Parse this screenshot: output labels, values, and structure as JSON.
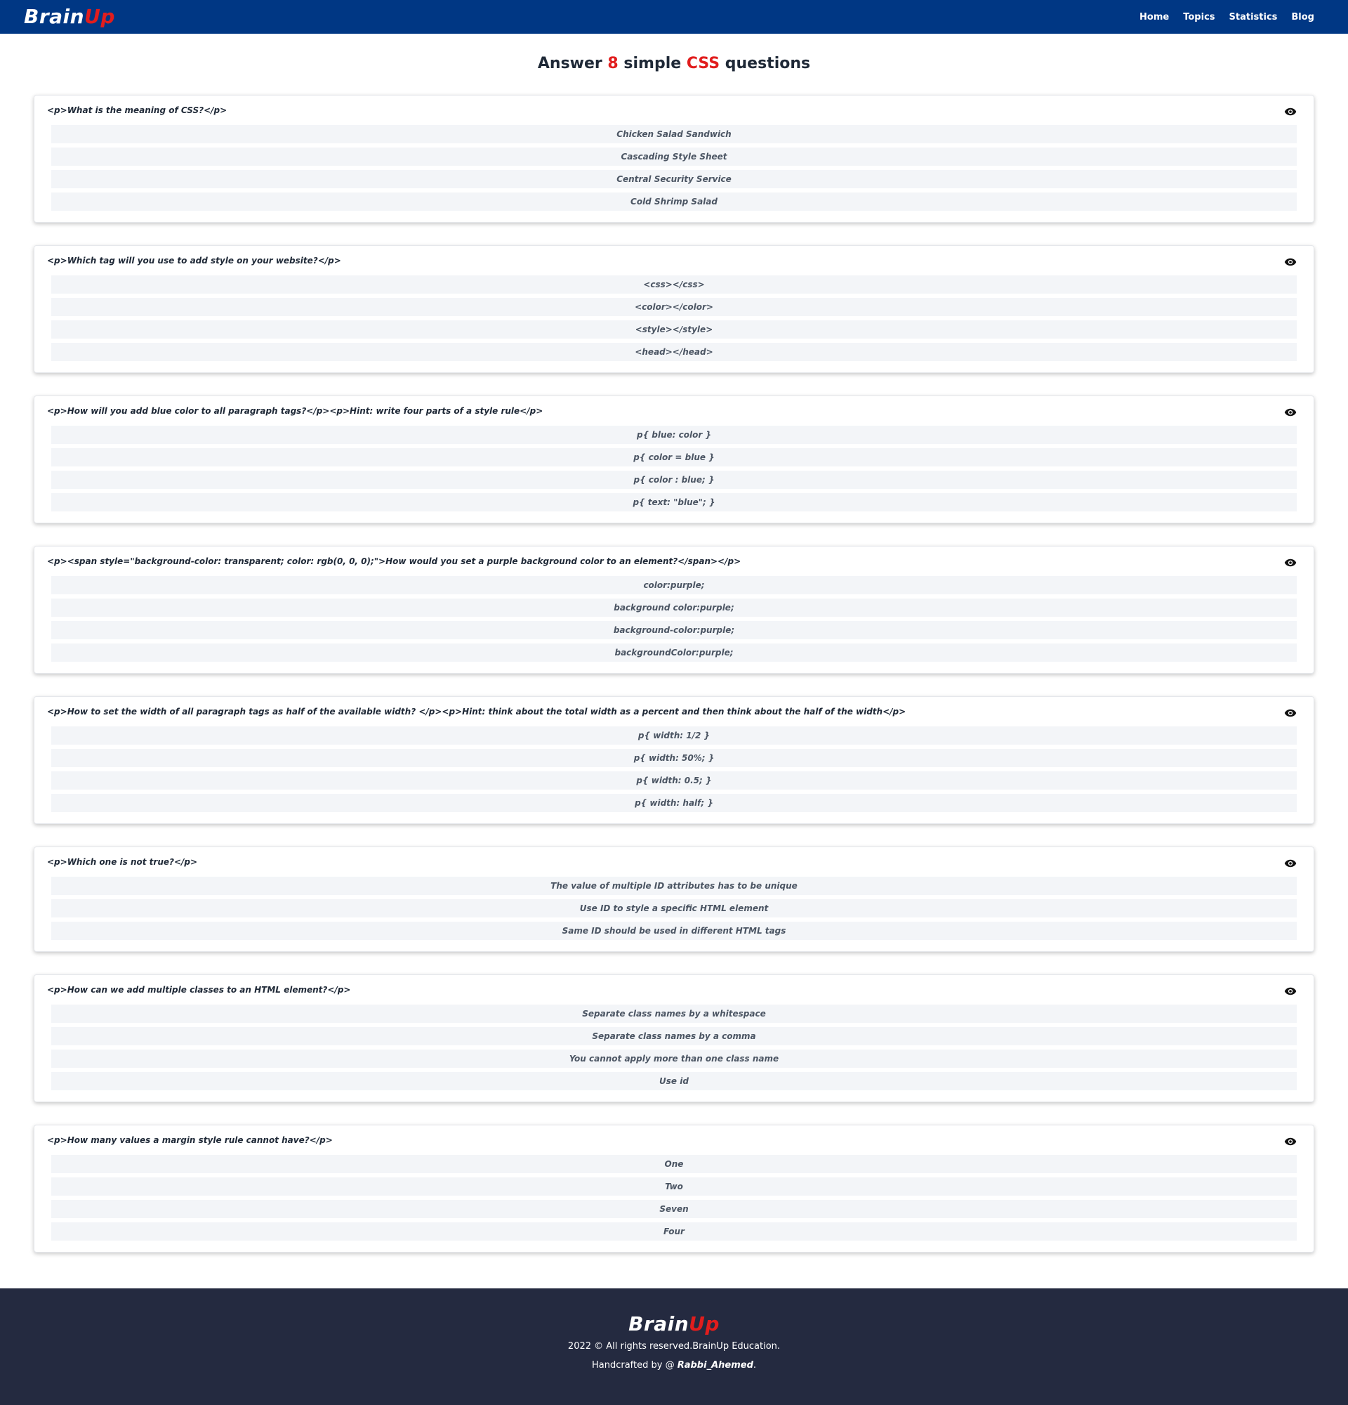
{
  "nav": {
    "brand_part1": "Brain",
    "brand_part2": "Up",
    "links": [
      "Home",
      "Topics",
      "Statistics",
      "Blog"
    ]
  },
  "title": {
    "prefix": "Answer ",
    "count": "8",
    "middle": " simple ",
    "topic": "CSS",
    "suffix": " questions"
  },
  "quizzes": [
    {
      "question": "<p>What is the meaning of CSS?</p>",
      "options": [
        "Chicken Salad Sandwich",
        "Cascading Style Sheet",
        "Central Security Service",
        "Cold Shrimp Salad"
      ]
    },
    {
      "question": "<p>Which tag will you use to add style on your website?</p>",
      "options": [
        "<css></css>",
        "<color></color>",
        "<style></style>",
        "<head></head>"
      ]
    },
    {
      "question": "<p>How will you add blue color to all paragraph tags?</p><p>Hint: write four parts of a style rule</p>",
      "options": [
        "p{ blue: color }",
        "p{ color = blue }",
        "p{ color : blue; }",
        "p{ text: \"blue\"; }"
      ]
    },
    {
      "question": "<p><span style=\"background-color: transparent; color: rgb(0, 0, 0);\">How would you set a purple background color to an element?</span></p>",
      "options": [
        "color:purple;",
        "background color:purple;",
        "background-color:purple;",
        "backgroundColor:purple;"
      ]
    },
    {
      "question": "<p>How to set the width of all paragraph tags as half of the available width? </p><p>Hint: think about the total width as a percent and then think about the half of the width</p>",
      "options": [
        "p{ width: 1/2 }",
        "p{ width: 50%; }",
        "p{ width: 0.5; }",
        "p{ width: half; }"
      ]
    },
    {
      "question": "<p>Which one is not true?</p>",
      "options": [
        "The value of multiple ID attributes has to be unique",
        "Use ID to style a specific HTML element",
        "Same ID should be used in different HTML tags"
      ]
    },
    {
      "question": "<p>How can we add multiple classes to an HTML element?</p>",
      "options": [
        "Separate class names by a whitespace",
        "Separate class names by a comma",
        "You cannot apply more than one class name",
        "Use id"
      ]
    },
    {
      "question": "<p>How many values a margin style rule cannot have?</p>",
      "options": [
        "One",
        "Two",
        "Seven",
        "Four"
      ]
    }
  ],
  "footer": {
    "brand_part1": "Brain",
    "brand_part2": "Up",
    "copyright": "2022 © All rights reserved.BrainUp Education.",
    "crafted_prefix": "Handcrafted by @ ",
    "author": "Rabbi_Ahemed",
    "crafted_suffix": "."
  },
  "colors": {
    "navbar_bg": "#003784",
    "accent_red": "#e11d1d",
    "footer_bg": "#242a40",
    "option_bg": "#f3f5f8"
  },
  "icons": {
    "reveal": "eye-icon"
  }
}
